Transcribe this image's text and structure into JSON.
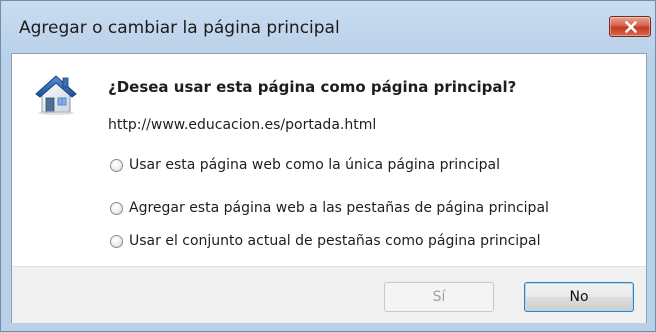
{
  "window": {
    "title": "Agregar o cambiar la página principal",
    "close_icon": "close-x-icon",
    "close_color": "#c23a22"
  },
  "dialog": {
    "icon": "home-icon",
    "question": "¿Desea usar esta página como página principal?",
    "url": "http://www.educacion.es/portada.html",
    "options": [
      {
        "label": "Usar esta página web como la única página principal",
        "selected": false
      },
      {
        "label": "Agregar esta página web a las pestañas de página principal",
        "selected": false
      },
      {
        "label": "Usar el conjunto actual de pestañas como página principal",
        "selected": false
      }
    ],
    "buttons": {
      "yes": {
        "label": "Sí",
        "enabled": false
      },
      "no": {
        "label": "No",
        "enabled": true,
        "default": true
      }
    }
  }
}
